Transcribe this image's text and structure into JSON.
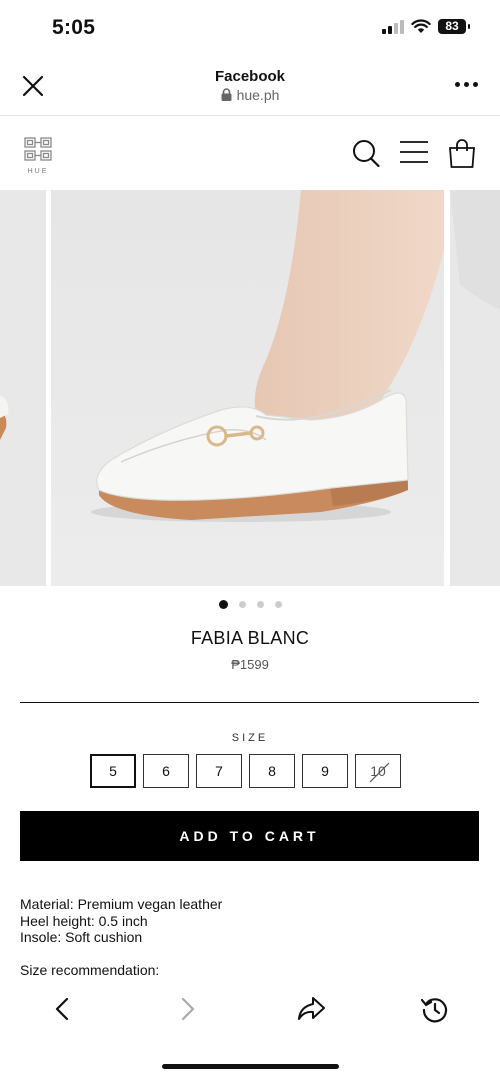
{
  "status_bar": {
    "time": "5:05",
    "battery": "83"
  },
  "browser": {
    "title": "Facebook",
    "url": "hue.ph",
    "close_icon": "close-icon",
    "more_icon": "more-horizontal-icon"
  },
  "site": {
    "logo_text": "HUE",
    "icons": [
      "search-icon",
      "menu-icon",
      "shopping-bag-icon"
    ]
  },
  "carousel": {
    "total_slides": 4,
    "active_index": 0
  },
  "product": {
    "name": "FABIA BLANC",
    "price": "₱1599"
  },
  "size": {
    "label": "SIZE",
    "options": [
      "5",
      "6",
      "7",
      "8",
      "9",
      "10"
    ],
    "selected": "5",
    "unavailable": [
      "10"
    ]
  },
  "cart": {
    "button_label": "ADD TO CART"
  },
  "details": {
    "material": "Material: Premium vegan leather",
    "heel": "Heel height: 0.5 inch",
    "insole": "Insole: Soft cushion",
    "size_recommendation": "Size recommendation:"
  },
  "toolbar": {
    "icons": [
      "back-icon",
      "forward-icon",
      "share-icon",
      "history-icon"
    ]
  },
  "colors": {
    "accent": "#000000",
    "background": "#ffffff",
    "muted": "#cccccc"
  }
}
